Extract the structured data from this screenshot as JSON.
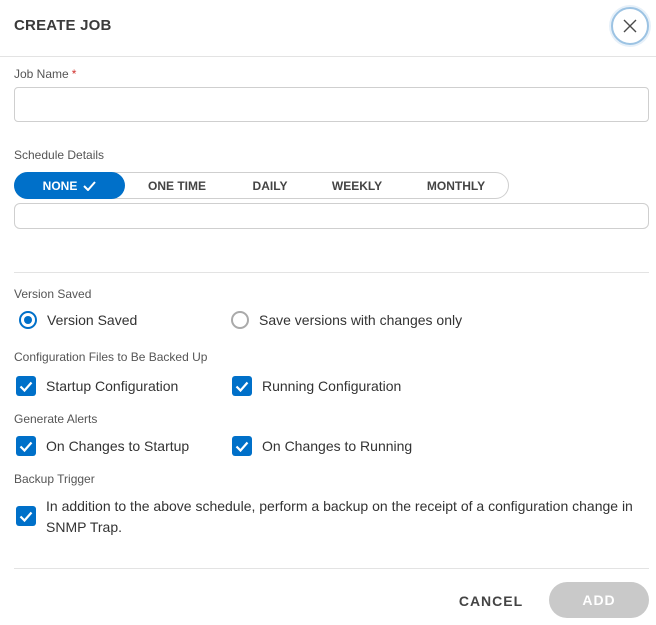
{
  "dialog": {
    "title": "CREATE JOB",
    "close_icon": "close-icon"
  },
  "job_name": {
    "label": "Job Name",
    "required_marker": "*",
    "value": "",
    "placeholder": ""
  },
  "schedule": {
    "label": "Schedule Details",
    "options": [
      "NONE",
      "ONE TIME",
      "DAILY",
      "WEEKLY",
      "MONTHLY"
    ],
    "selected": "NONE",
    "detail_value": ""
  },
  "version_saved": {
    "label": "Version Saved",
    "options": [
      {
        "label": "Version Saved",
        "checked": true
      },
      {
        "label": "Save versions with changes only",
        "checked": false
      }
    ]
  },
  "config_files": {
    "label": "Configuration Files to Be Backed Up",
    "options": [
      {
        "label": "Startup Configuration",
        "checked": true
      },
      {
        "label": "Running Configuration",
        "checked": true
      }
    ]
  },
  "alerts": {
    "label": "Generate Alerts",
    "options": [
      {
        "label": "On Changes to Startup",
        "checked": true
      },
      {
        "label": "On Changes to Running",
        "checked": true
      }
    ]
  },
  "backup_trigger": {
    "label": "Backup Trigger",
    "checked": true,
    "text": "In addition to the above schedule, perform a backup on the receipt of a configuration change in SNMP Trap."
  },
  "footer": {
    "cancel_label": "CANCEL",
    "add_label": "ADD"
  },
  "colors": {
    "accent": "#0070c9",
    "disabled_button": "#c9c9c9",
    "required": "#d0322f"
  }
}
